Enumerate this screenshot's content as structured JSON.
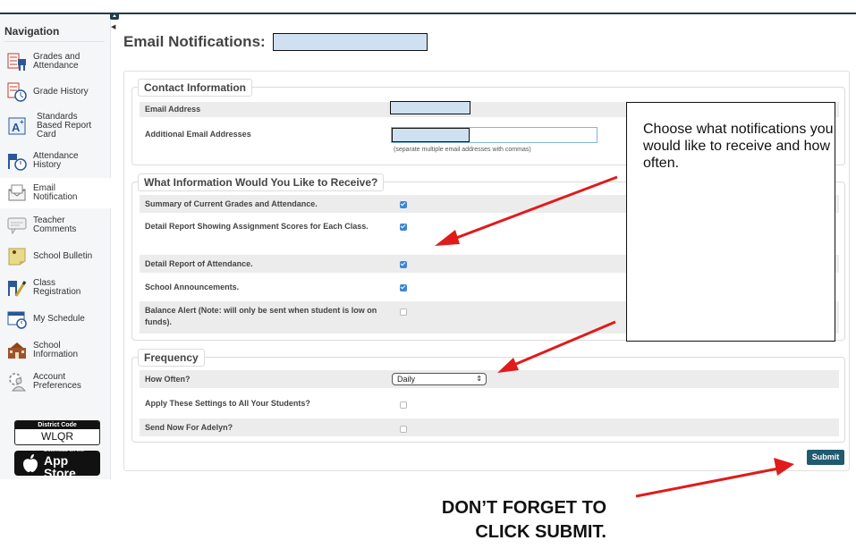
{
  "sidebar": {
    "title": "Navigation",
    "items": [
      {
        "label_1": "Grades and",
        "label_2": "Attendance",
        "icon": "grades-attendance-icon"
      },
      {
        "label_1": "Grade History",
        "label_2": "",
        "icon": "grade-history-icon"
      },
      {
        "label_1": "Standards",
        "label_2": "Based Report",
        "label_3": "Card",
        "icon": "standards-report-card-icon"
      },
      {
        "label_1": "Attendance",
        "label_2": "History",
        "icon": "attendance-history-icon"
      },
      {
        "label_1": "Email",
        "label_2": "Notification",
        "icon": "email-notification-icon",
        "active": true
      },
      {
        "label_1": "Teacher",
        "label_2": "Comments",
        "icon": "teacher-comments-icon"
      },
      {
        "label_1": "School Bulletin",
        "label_2": "",
        "icon": "school-bulletin-icon"
      },
      {
        "label_1": "Class",
        "label_2": "Registration",
        "icon": "class-registration-icon"
      },
      {
        "label_1": "My Schedule",
        "label_2": "",
        "icon": "my-schedule-icon"
      },
      {
        "label_1": "School",
        "label_2": "Information",
        "icon": "school-information-icon"
      },
      {
        "label_1": "Account",
        "label_2": "Preferences",
        "icon": "account-preferences-icon"
      }
    ],
    "district_code_label": "District Code",
    "district_code": "WLQR",
    "app_store_line1": "Download on the",
    "app_store_line2": "App Store"
  },
  "page": {
    "title": "Email Notifications:"
  },
  "contact": {
    "legend": "Contact Information",
    "email_label": "Email Address",
    "additional_label": "Additional Email Addresses",
    "additional_hint": "(separate multiple email addresses with commas)"
  },
  "receive": {
    "legend": "What Information Would You Like to Receive?",
    "options": [
      {
        "label": "Summary of Current Grades and Attendance.",
        "checked": true
      },
      {
        "label": "Detail Report Showing Assignment Scores for Each Class.",
        "checked": true
      },
      {
        "label": "Detail Report of Attendance.",
        "checked": true
      },
      {
        "label": "School Announcements.",
        "checked": true
      },
      {
        "label": "Balance Alert (Note: will only be sent when student is low on funds).",
        "checked": false
      }
    ]
  },
  "frequency": {
    "legend": "Frequency",
    "how_often_label": "How Often?",
    "how_often_value": "Daily",
    "apply_all_label": "Apply These Settings to All Your Students?",
    "apply_all_checked": false,
    "send_now_label": "Send Now For Adelyn?",
    "send_now_checked": false
  },
  "submit_label": "Submit",
  "annotations": {
    "callout": "Choose what notifications you would like to receive and how often.",
    "bottom_line1": "DON’T FORGET TO",
    "bottom_line2": "CLICK SUBMIT.",
    "arrow_color": "#e01b1b"
  },
  "colors": {
    "accent": "#205a6f",
    "checkbox": "#3b86d6",
    "redaction": "#cfe0f1"
  }
}
